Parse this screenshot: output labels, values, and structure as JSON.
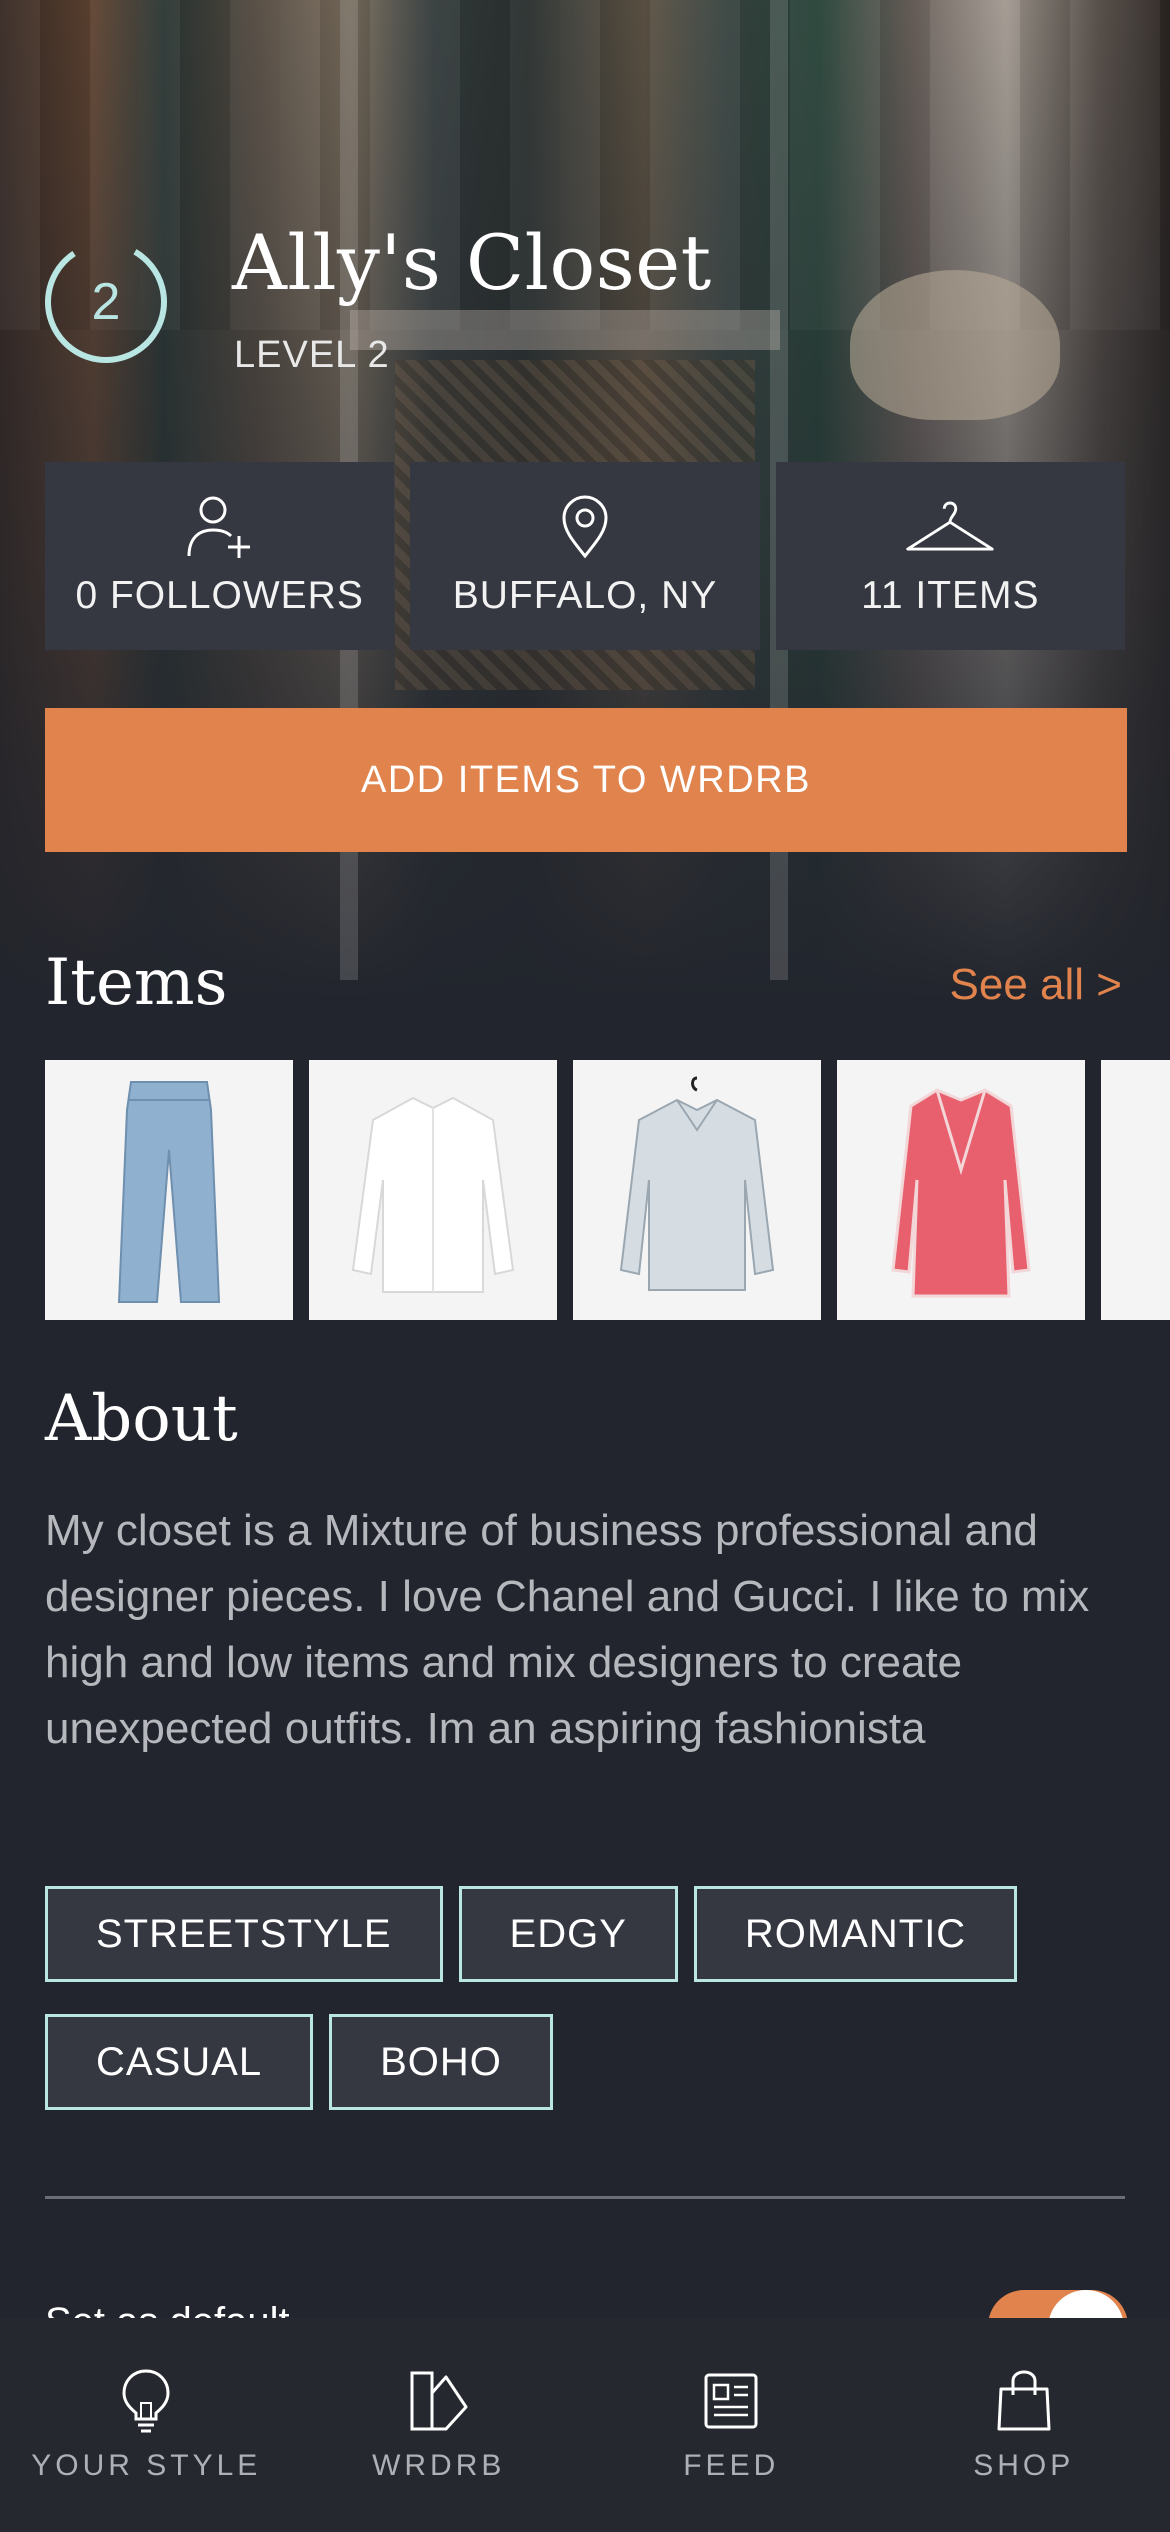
{
  "profile": {
    "level_number": "2",
    "title": "Ally's Closet",
    "level_label": "LEVEL 2"
  },
  "stats": [
    {
      "icon": "add-person-icon",
      "label": "0 FOLLOWERS"
    },
    {
      "icon": "location-pin-icon",
      "label": "BUFFALO, NY"
    },
    {
      "icon": "hanger-icon",
      "label": "11 ITEMS"
    }
  ],
  "cta": {
    "label": "ADD ITEMS TO WRDRB"
  },
  "items": {
    "title": "Items",
    "see_all": "See all >",
    "thumbnails": [
      "jeans-image",
      "white-shirt-image",
      "light-blue-shirt-image",
      "pink-blazer-dress-image",
      "partial-item-image"
    ]
  },
  "about": {
    "title": "About",
    "text": "My closet is a Mixture of business professional and designer pieces. I love Chanel and Gucci. I like to mix high and low items and mix designers to create unexpected outfits. Im an aspiring fashionista"
  },
  "tags": [
    "STREETSTYLE",
    "EDGY",
    "ROMANTIC",
    "CASUAL",
    "BOHO"
  ],
  "partial_setting": {
    "label": "Set as default"
  },
  "bottom_nav": [
    {
      "icon": "lightbulb-icon",
      "label": "YOUR STYLE"
    },
    {
      "icon": "wardrobe-icon",
      "label": "WRDRB"
    },
    {
      "icon": "newspaper-icon",
      "label": "FEED"
    },
    {
      "icon": "shopping-bag-icon",
      "label": "SHOP"
    }
  ],
  "colors": {
    "background": "#22252d",
    "card": "#353841",
    "accent": "#e0834d",
    "teal": "#b9e6e3"
  }
}
